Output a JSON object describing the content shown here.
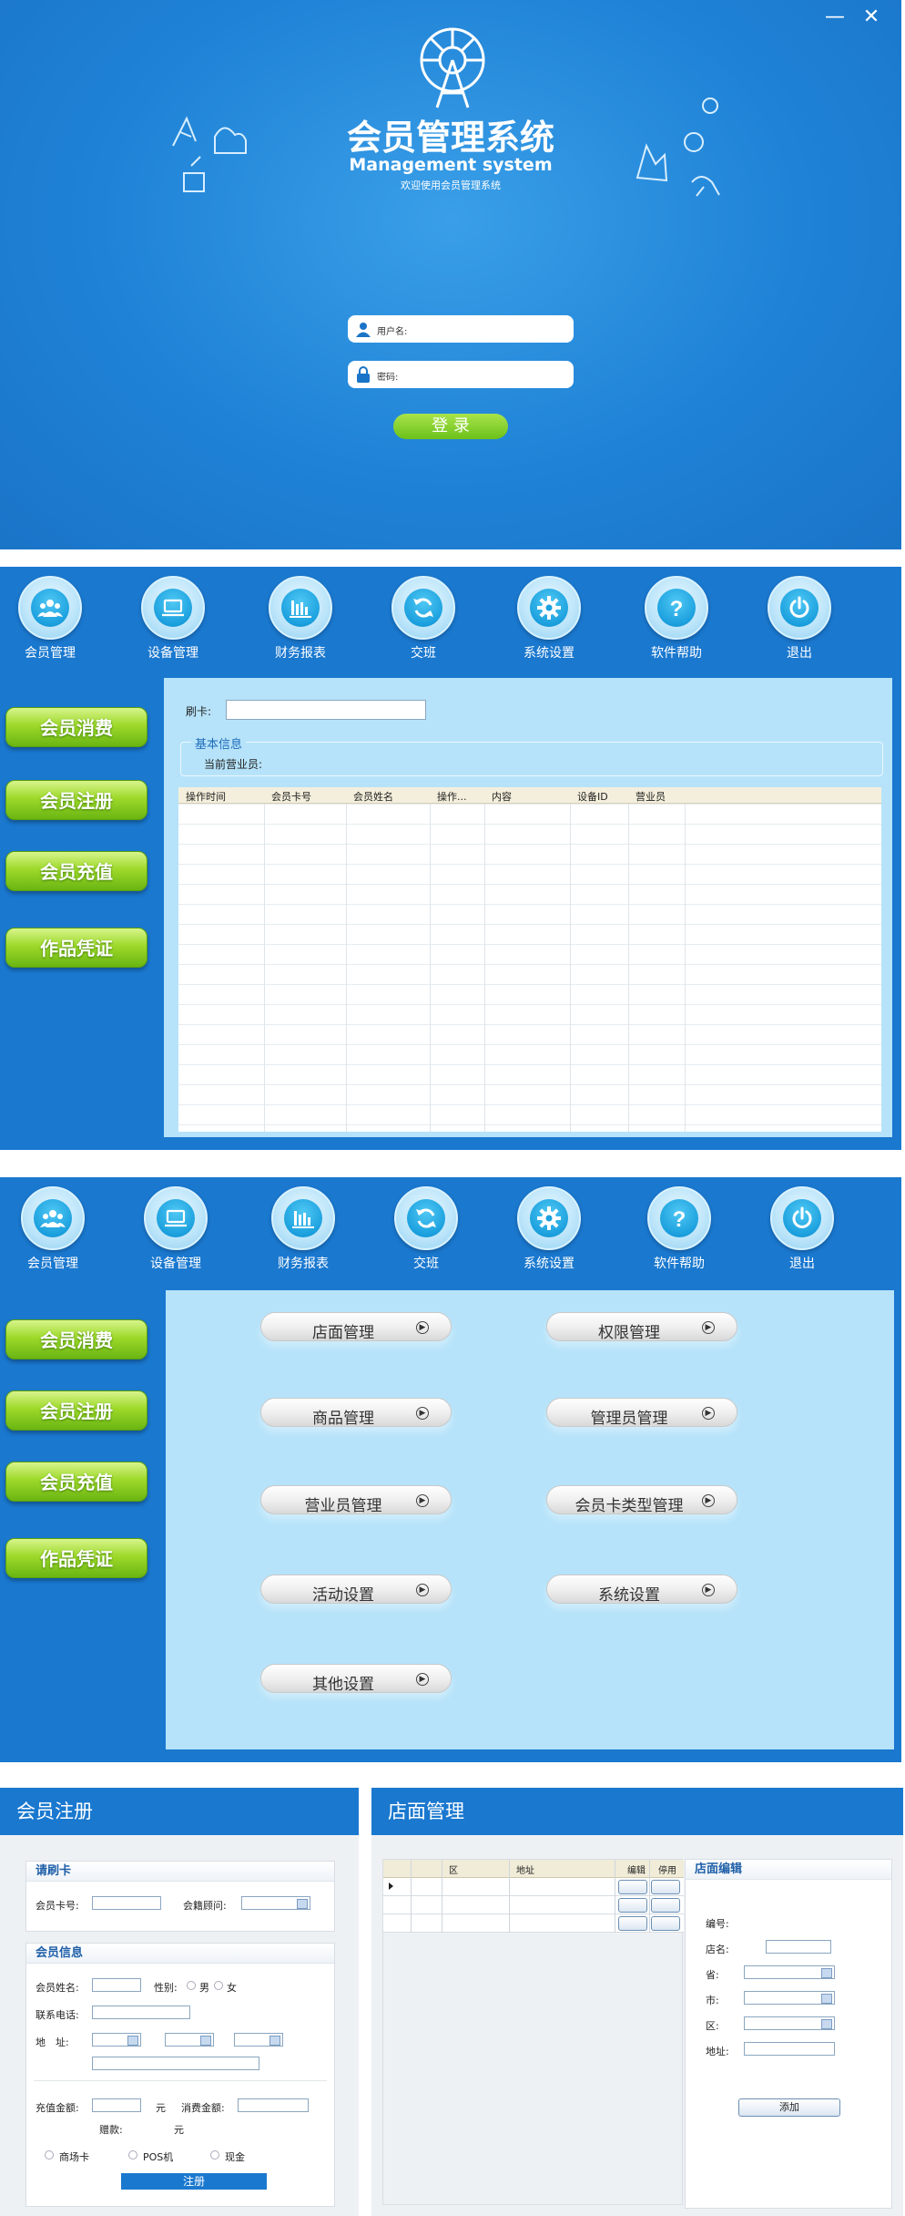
{
  "colors": {
    "primary_blue": "#1a78cf",
    "light_blue": "#b6e3fa",
    "green_button": "#7cc41e",
    "white": "#ffffff"
  },
  "login": {
    "title_cn": "会员管理系统",
    "title_en": "Management system",
    "subtitle": "欢迎使用会员管理系统",
    "username_placeholder": "用户名:",
    "password_placeholder": "密码:",
    "login_button": "登 录",
    "minimize_icon": "minimize-icon",
    "close_icon": "close-icon"
  },
  "toolbar": {
    "items": [
      {
        "label": "会员管理",
        "icon": "members-icon"
      },
      {
        "label": "设备管理",
        "icon": "device-icon"
      },
      {
        "label": "财务报表",
        "icon": "chart-icon"
      },
      {
        "label": "交班",
        "icon": "refresh-icon"
      },
      {
        "label": "系统设置",
        "icon": "gear-icon"
      },
      {
        "label": "软件帮助",
        "icon": "help-icon"
      },
      {
        "label": "退出",
        "icon": "power-icon"
      }
    ]
  },
  "sidebar": {
    "items": [
      "会员消费",
      "会员注册",
      "会员充值",
      "作品凭证"
    ]
  },
  "consume": {
    "swipe_label": "刷卡:",
    "basic_info_legend": "基本信息",
    "current_clerk_label": "当前营业员:",
    "columns": [
      "操作时间",
      "会员卡号",
      "会员姓名",
      "操作...",
      "内容",
      "设备ID",
      "营业员"
    ]
  },
  "settings": {
    "buttons": [
      "店面管理",
      "权限管理",
      "商品管理",
      "管理员管理",
      "营业员管理",
      "会员卡类型管理",
      "活动设置",
      "系统设置",
      "其他设置"
    ]
  },
  "register": {
    "header": "会员注册",
    "swipe_card_title": "请刷卡",
    "card_no_label": "会员卡号:",
    "consultant_label": "会籍顾问:",
    "member_info_title": "会员信息",
    "name_label": "会员姓名:",
    "gender_label": "性别:",
    "male": "男",
    "female": "女",
    "phone_label": "联系电话:",
    "address_label": "地　址:",
    "recharge_label": "充值金额:",
    "yuan1": "元",
    "consume_amount_label": "消费金额:",
    "gift_label": "赠款:",
    "yuan2": "元",
    "pay_methods": [
      "商场卡",
      "POS机",
      "现金"
    ],
    "submit": "注册"
  },
  "store": {
    "header": "店面管理",
    "columns": [
      "区",
      "地址",
      "编辑",
      "停用"
    ],
    "edit_title": "店面编辑",
    "id_label": "编号:",
    "name_label": "店名:",
    "province_label": "省:",
    "city_label": "市:",
    "district_label": "区:",
    "address_label": "地址:",
    "add_button": "添加"
  }
}
